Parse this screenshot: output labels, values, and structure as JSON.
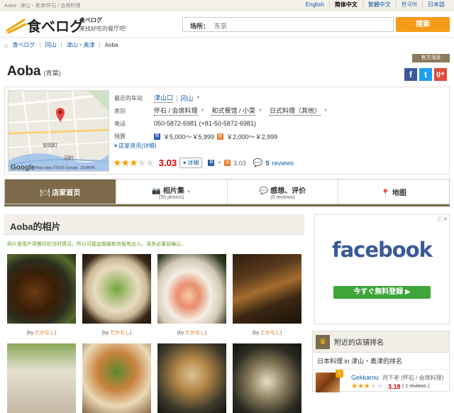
{
  "topbar": {
    "breadcrumb": "Aoba - 津山・奥津/怀石 / 会席料理",
    "languages": [
      {
        "label": "English",
        "current": false
      },
      {
        "label": "简体中文",
        "current": true
      },
      {
        "label": "繁體中文",
        "current": false
      },
      {
        "label": "한국어",
        "current": false
      },
      {
        "label": "日本語",
        "current": false
      }
    ]
  },
  "header": {
    "logo_text": "食べログ",
    "tagline_title": "食べログ",
    "tagline_sub": "来找好吃的餐厅吧!",
    "search_label": "场所：",
    "search_value": "东京",
    "search_button": "搜索"
  },
  "breadcrumb": {
    "home": "食べログ",
    "items": [
      "冈山",
      "津山・奥津",
      "Aoba"
    ]
  },
  "official_tag": "官方消息",
  "restaurant": {
    "name": "Aoba",
    "kana": "(青葉)",
    "social": {
      "facebook": "f",
      "twitter": "t",
      "gplus": "g+"
    },
    "details": {
      "station_label": "最近的车站",
      "station": [
        "津山口",
        "冈山"
      ],
      "category_label": "类别",
      "categories": [
        "怀石 / 会席料理",
        "和式餐馆 / 小菜",
        "日式料理（其他）"
      ],
      "phone_label": "电话",
      "phone": "050-5872-6981 (+81-50-5872-6981)",
      "budget_label": "预算",
      "budget_dinner": "￥5,000～￥5,999",
      "budget_lunch": "￥2,000～￥2,999",
      "budget_icon_dinner": "夜",
      "budget_icon_lunch": "昼"
    },
    "more_info": "店家资讯(详细)",
    "rating": {
      "stars_filled": 3,
      "stars_total": 5,
      "score": "3.03",
      "detail_button": "详细",
      "lunch_score": "3.03",
      "reviews_count": "5",
      "reviews_label": "reviews"
    },
    "map": {
      "attribution": "Map data ©2016 Google, ZENRIN",
      "google_logo": "Google",
      "labels": [
        "安岡町",
        "羽町"
      ]
    }
  },
  "tabs": [
    {
      "title": "店家首页",
      "sub": ""
    },
    {
      "title": "相片集",
      "sub": "(55 photos)"
    },
    {
      "title": "感想、评价",
      "sub": "(5 reviews)"
    },
    {
      "title": "地图",
      "sub": ""
    }
  ],
  "photos": {
    "heading": "Aoba的相片",
    "note": "照片是用户用餐时的当时情况，所以可能会跟最新信报有出入。请务必事前确认。",
    "items": [
      {
        "by_prefix": "(by ",
        "by": "たかなし",
        "by_suffix": ")"
      },
      {
        "by_prefix": "(by ",
        "by": "たかなし",
        "by_suffix": ")"
      },
      {
        "by_prefix": "(by ",
        "by": "たかなし",
        "by_suffix": ")"
      },
      {
        "by_prefix": "(by ",
        "by": "たかなし",
        "by_suffix": ")"
      }
    ]
  },
  "ad": {
    "brand": "facebook",
    "cta": "今すぐ無料登録 ▶",
    "close": "ⓘ ✕"
  },
  "ranking": {
    "heading": "附近的店铺排名",
    "subheading": "日本料理 in 津山・奥津的排名",
    "item": {
      "rank": "1",
      "name": "Gekkarou",
      "area": "月下老",
      "category": "(怀石 / 会席料理)",
      "score": "3.18",
      "reviews": "( 1 reviews )"
    }
  }
}
